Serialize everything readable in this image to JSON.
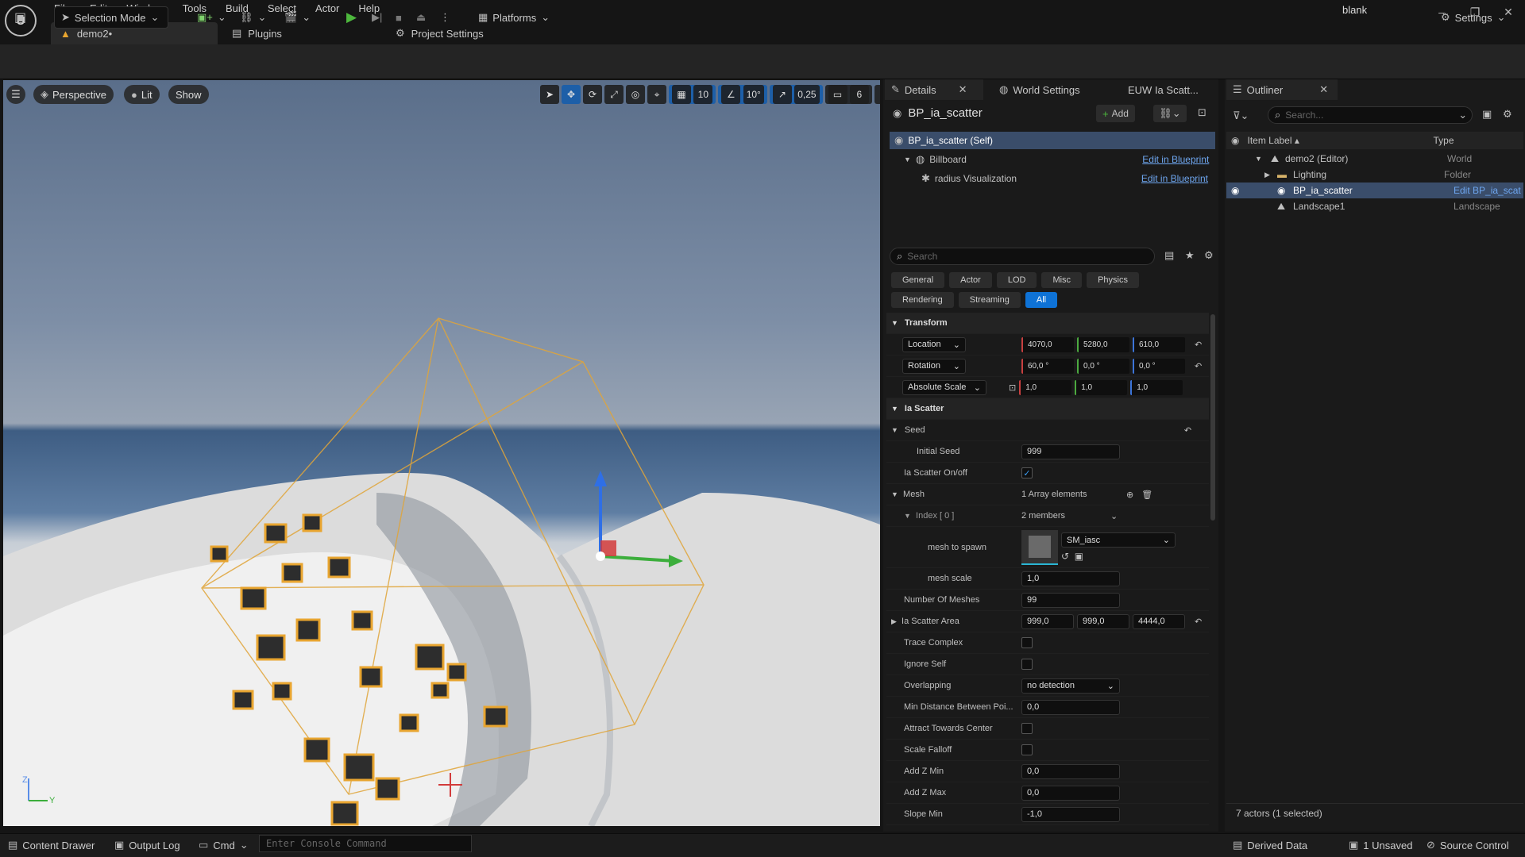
{
  "window": {
    "logo": "U",
    "menu": [
      "File",
      "Edit",
      "Window",
      "Tools",
      "Build",
      "Select",
      "Actor",
      "Help"
    ],
    "tabs": [
      {
        "label": "demo2•"
      },
      {
        "label": "Plugins"
      },
      {
        "label": "Project Settings"
      }
    ],
    "project": "blank",
    "controls": [
      "–",
      "❐",
      "✕"
    ]
  },
  "toolbar": {
    "selection_mode": "Selection Mode",
    "platforms": "Platforms",
    "settings": "Settings"
  },
  "viewport": {
    "perspective": "Perspective",
    "lit": "Lit",
    "show": "Show",
    "grid_snap": "10",
    "angle_snap": "10°",
    "scale_snap": "0,25",
    "camera_speed": "6",
    "axis_z": "Z",
    "axis_y": "Y"
  },
  "details": {
    "tabs": [
      "Details",
      "World Settings",
      "EUW Ia Scatt..."
    ],
    "actor_name": "BP_ia_scatter",
    "add_label": "Add",
    "self_item": "BP_ia_scatter (Self)",
    "components": [
      {
        "name": "Billboard",
        "link": "Edit in Blueprint"
      },
      {
        "name": "radius Visualization",
        "link": "Edit in Blueprint"
      }
    ],
    "search_placeholder": "Search",
    "filters_row1": [
      "General",
      "Actor",
      "LOD",
      "Misc",
      "Physics"
    ],
    "filters_row2": [
      "Rendering",
      "Streaming",
      "All"
    ],
    "transform": {
      "header": "Transform",
      "location": {
        "label": "Location",
        "x": "4070,0",
        "y": "5280,0",
        "z": "610,0"
      },
      "rotation": {
        "label": "Rotation",
        "x": "60,0 °",
        "y": "0,0 °",
        "z": "0,0 °"
      },
      "scale": {
        "label": "Absolute Scale",
        "x": "1,0",
        "y": "1,0",
        "z": "1,0"
      }
    },
    "ia_scatter": {
      "header": "Ia Scatter",
      "seed": "Seed",
      "initial_seed_label": "Initial Seed",
      "initial_seed": "999",
      "onoff_label": "Ia Scatter On/off",
      "mesh_label": "Mesh",
      "mesh_elements": "1 Array elements",
      "index_label": "Index [ 0 ]",
      "members": "2 members",
      "mesh_to_spawn_label": "mesh to spawn",
      "mesh_to_spawn": "SM_iasc",
      "mesh_scale_label": "mesh scale",
      "mesh_scale": "1,0",
      "num_meshes_label": "Number Of Meshes",
      "num_meshes": "99",
      "area_label": "Ia Scatter Area",
      "area_x": "999,0",
      "area_y": "999,0",
      "area_z": "4444,0",
      "trace_label": "Trace Complex",
      "ignore_self_label": "Ignore Self",
      "overlapping_label": "Overlapping",
      "overlapping": "no detection",
      "min_dist_label": "Min Distance Between Poi...",
      "min_dist": "0,0",
      "attract_label": "Attract Towards Center",
      "falloff_label": "Scale Falloff",
      "add_z_min_label": "Add Z Min",
      "add_z_min": "0,0",
      "add_z_max_label": "Add Z Max",
      "add_z_max": "0,0",
      "slope_min_label": "Slope Min",
      "slope_min": "-1,0"
    }
  },
  "outliner": {
    "title": "Outliner",
    "search_placeholder": "Search...",
    "col_label": "Item Label ▴",
    "col_type": "Type",
    "items": [
      {
        "label": "demo2 (Editor)",
        "type": "World"
      },
      {
        "label": "Lighting",
        "type": "Folder"
      },
      {
        "label": "BP_ia_scatter",
        "type": "Edit BP_ia_scat"
      },
      {
        "label": "Landscape1",
        "type": "Landscape"
      }
    ],
    "footer": "7 actors (1 selected)"
  },
  "statusbar": {
    "content_drawer": "Content Drawer",
    "output_log": "Output Log",
    "cmd": "Cmd",
    "console_placeholder": "Enter Console Command",
    "derived_data": "Derived Data",
    "unsaved": "1 Unsaved",
    "source_control": "Source Control"
  },
  "colors": {
    "accent": "#0e72d6",
    "selection": "#e8a530",
    "gizmo_z": "#2f6fe6",
    "gizmo_y": "#3cae3c",
    "gizmo_x": "#d23b3b"
  },
  "icons": [
    "unreal-logo-icon",
    "save-icon",
    "play-icon",
    "search-icon",
    "eye-icon",
    "folder-icon",
    "gear-icon"
  ]
}
